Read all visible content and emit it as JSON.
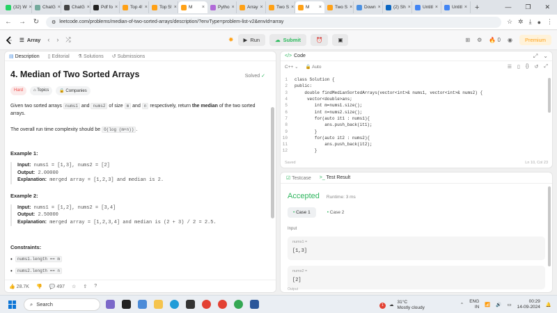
{
  "browser": {
    "tabs": [
      {
        "title": "(32) W",
        "color": "#25d366"
      },
      {
        "title": "ChatG",
        "color": "#74aa9c"
      },
      {
        "title": "ChatG",
        "color": "#444444"
      },
      {
        "title": "Pdf fo",
        "color": "#222222"
      },
      {
        "title": "Top 4!",
        "color": "#ffa116"
      },
      {
        "title": "Top 5!",
        "color": "#ffa116"
      },
      {
        "title": "M",
        "color": "#ffa116",
        "active": true
      },
      {
        "title": "Pytho",
        "color": "#b16ad8"
      },
      {
        "title": "Array",
        "color": "#ffa116"
      },
      {
        "title": "Two S",
        "color": "#ffa116"
      },
      {
        "title": "M",
        "color": "#ffa116",
        "active": true
      },
      {
        "title": "Two S",
        "color": "#ffa116"
      },
      {
        "title": "Down",
        "color": "#4a90e2"
      },
      {
        "title": "(2) Sh",
        "color": "#0a66c2"
      },
      {
        "title": "Untitl",
        "color": "#4285f4"
      },
      {
        "title": "Untitl",
        "color": "#4285f4"
      }
    ],
    "url": "leetcode.com/problems/median-of-two-sorted-arrays/description/?envType=problem-list-v2&envId=array"
  },
  "header": {
    "list_label": "Array",
    "run_label": "Run",
    "submit_label": "Submit",
    "streak_count": "0",
    "premium_label": "Premium"
  },
  "left_tabs": [
    "Description",
    "Editorial",
    "Solutions",
    "Submissions"
  ],
  "problem": {
    "title": "4. Median of Two Sorted Arrays",
    "solved_label": "Solved",
    "difficulty": "Hard",
    "topics_label": "Topics",
    "companies_label": "Companies",
    "desc_a": "Given two sorted arrays ",
    "nums1": "nums1",
    "desc_b": " and ",
    "nums2": "nums2",
    "desc_c": " of size ",
    "m": "m",
    "desc_d": " and ",
    "n": "n",
    "desc_e": " respectively, return ",
    "desc_bold": "the median",
    "desc_f": " of the two sorted arrays.",
    "complexity_text": "The overall run time complexity should be ",
    "complexity_code": "O(log (m+n))",
    "complexity_end": ".",
    "examples": [
      {
        "heading": "Example 1:",
        "input_label": "Input:",
        "input": " nums1 = [1,3], nums2 = [2]",
        "output_label": "Output:",
        "output": " 2.00000",
        "expl_label": "Explanation:",
        "expl": " merged array = [1,2,3] and median is 2."
      },
      {
        "heading": "Example 2:",
        "input_label": "Input:",
        "input": " nums1 = [1,2], nums2 = [3,4]",
        "output_label": "Output:",
        "output": " 2.50000",
        "expl_label": "Explanation:",
        "expl": " merged array = [1,2,3,4] and median is (2 + 3) / 2 = 2.5."
      }
    ],
    "constraints_heading": "Constraints:",
    "constraints": [
      "nums1.length == m",
      "nums2.length == n"
    ],
    "likes": "28.7K",
    "comments": "497"
  },
  "code_panel": {
    "title": "Code",
    "language": "C++",
    "mode": "Auto",
    "saved": "Saved",
    "cursor": "Ln 10, Col 23",
    "lines": [
      "class Solution {",
      "public:",
      "    double findMedianSortedArrays(vector<int>& nums1, vector<int>& nums2) {",
      "     vector<double>ans;",
      "        int m=nums1.size();",
      "        int n=nums2.size();",
      "        for(auto it1 : nums1){",
      "            ans.push_back(it1);",
      "        }",
      "        for(auto it2 : nums2){",
      "            ans.push_back(it2);",
      "        }"
    ]
  },
  "result_panel": {
    "testcase_tab": "Testcase",
    "result_tab": "Test Result",
    "status": "Accepted",
    "runtime": "Runtime: 3 ms",
    "cases": [
      "Case 1",
      "Case 2"
    ],
    "input_label": "Input",
    "params": [
      {
        "name": "nums1 =",
        "value": "[1,3]"
      },
      {
        "name": "nums2 =",
        "value": "[2]"
      }
    ],
    "output_label": "Output"
  },
  "taskbar": {
    "search_label": "Search",
    "weather_temp": "31°C",
    "weather_desc": "Mostly cloudy",
    "weather_badge": "1",
    "lang_1": "ENG",
    "lang_2": "IN",
    "time": "00:29",
    "date": "14-09-2024"
  },
  "colors": {
    "accent": "#ffa116",
    "accepted": "#2db55d",
    "hard": "#ef4743"
  }
}
